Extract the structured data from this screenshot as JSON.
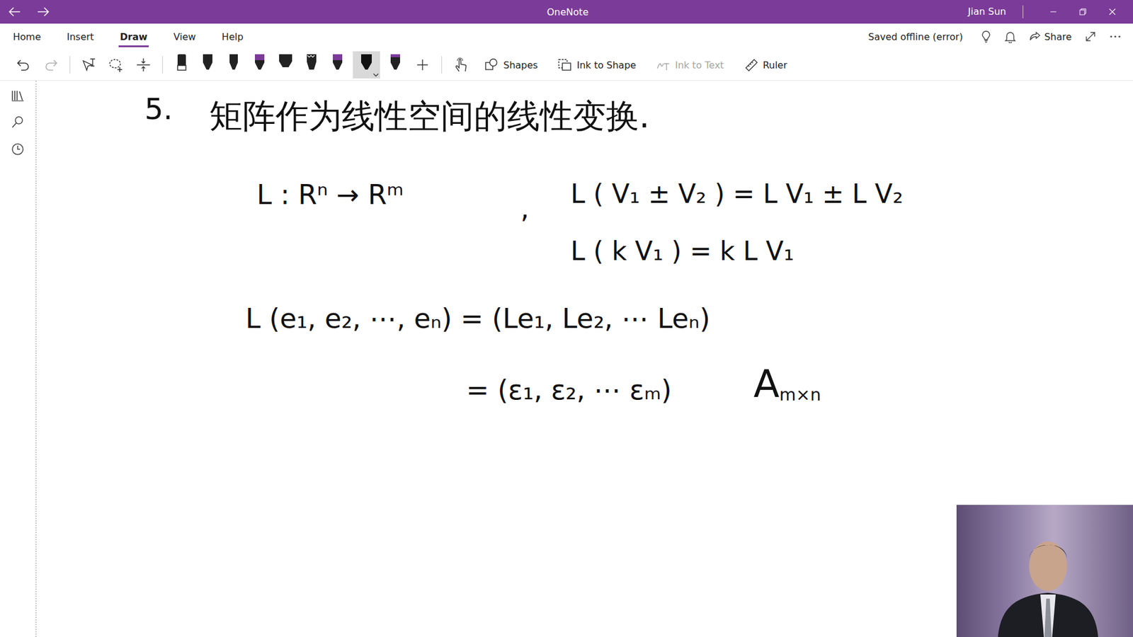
{
  "window": {
    "title": "OneNote",
    "user": "Jian Sun"
  },
  "ribbon_tabs": [
    {
      "label": "Home",
      "selected": false
    },
    {
      "label": "Insert",
      "selected": false
    },
    {
      "label": "Draw",
      "selected": true
    },
    {
      "label": "View",
      "selected": false
    },
    {
      "label": "Help",
      "selected": false
    }
  ],
  "status": {
    "save_state": "Saved offline (error)",
    "share": "Share"
  },
  "toolbar": {
    "undo": {
      "disabled": false
    },
    "redo": {
      "disabled": true
    },
    "pens": [
      {
        "selected": false
      },
      {
        "selected": false
      },
      {
        "selected": false
      },
      {
        "selected": false
      },
      {
        "selected": false
      },
      {
        "selected": false
      },
      {
        "selected": false
      },
      {
        "selected": true
      },
      {
        "selected": false
      }
    ],
    "buttons": [
      {
        "label": "Shapes",
        "disabled": false
      },
      {
        "label": "Ink to Shape",
        "disabled": false
      },
      {
        "label": "Ink to Text",
        "disabled": true
      },
      {
        "label": "Ruler",
        "disabled": false
      }
    ]
  },
  "page": {
    "heading": {
      "number": "5.",
      "title": "矩阵作为线性空间的线性变换."
    },
    "ink": [
      {
        "text": "L : Rⁿ → Rᵐ"
      },
      {
        "text": ","
      },
      {
        "text": "L ( V₁ ± V₂ ) = L V₁ ± L V₂"
      },
      {
        "text": "L ( k V₁ ) = k L V₁"
      },
      {
        "text": "L (e₁, e₂, ⋯, eₙ) = (Le₁, Le₂, ⋯ Leₙ)"
      },
      {
        "text": "= (ε₁, ε₂, ⋯ εₘ)"
      },
      {
        "text": "A",
        "subscript": "m×n"
      }
    ]
  }
}
